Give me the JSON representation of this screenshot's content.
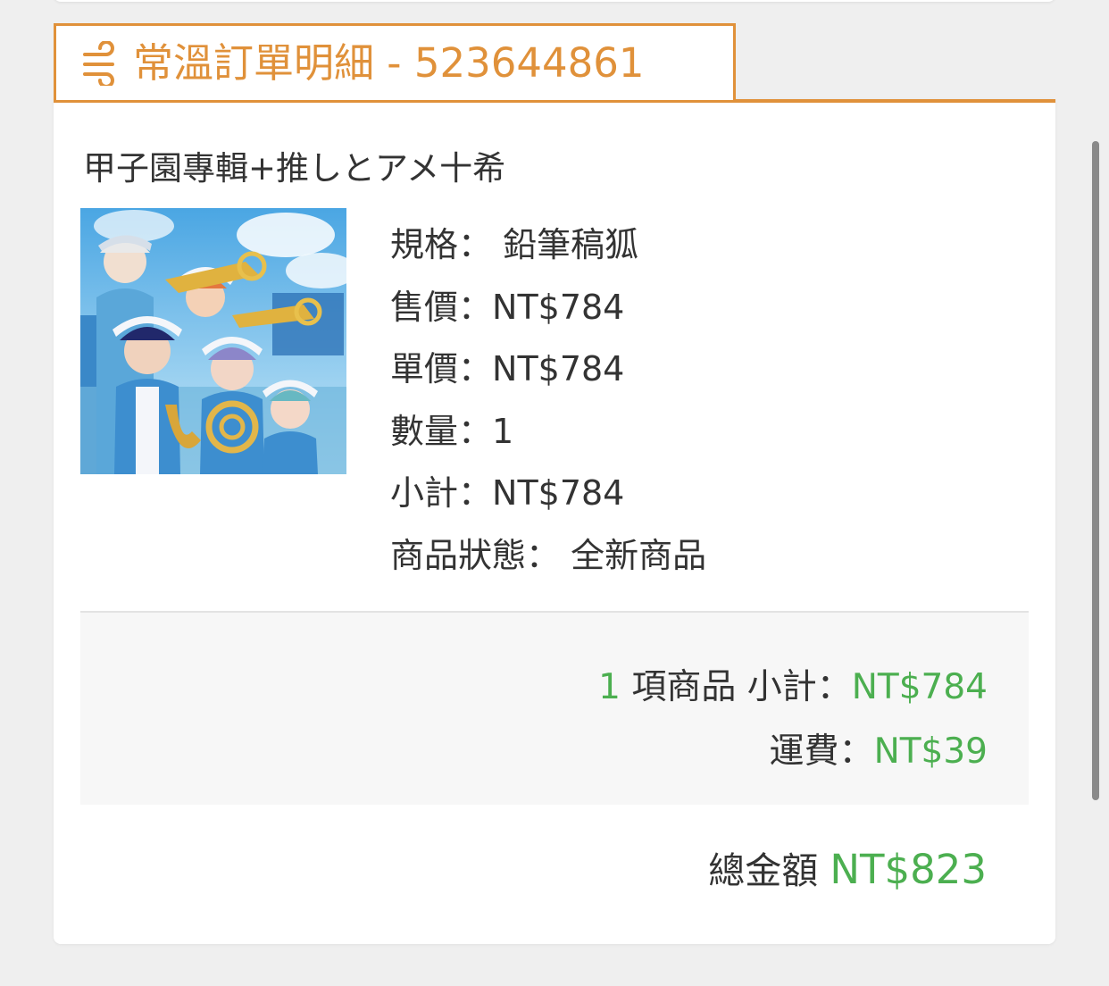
{
  "order_tab": {
    "title": "常溫訂單明細 - 523644861",
    "icon": "temperature-wind-icon",
    "accent_color": "#e0913a"
  },
  "product": {
    "name": "甲子園專輯+推しとアメ十希",
    "image": "album-cover-illustration",
    "details": [
      {
        "label": "規格：",
        "value": " 鉛筆稿狐"
      },
      {
        "label": "售價：",
        "value": "NT$784"
      },
      {
        "label": "單價：",
        "value": "NT$784"
      },
      {
        "label": "數量：",
        "value": "1"
      },
      {
        "label": "小計：",
        "value": "NT$784"
      },
      {
        "label": "商品狀態：",
        "value": " 全新商品"
      }
    ]
  },
  "summary": {
    "item_count": "1",
    "item_count_suffix": " 項商品 小計：",
    "subtotal": "NT$784",
    "shipping_label": "運費：",
    "shipping": "NT$39",
    "total_label": "總金額 ",
    "total": "NT$823",
    "value_color": "#4caf50"
  }
}
